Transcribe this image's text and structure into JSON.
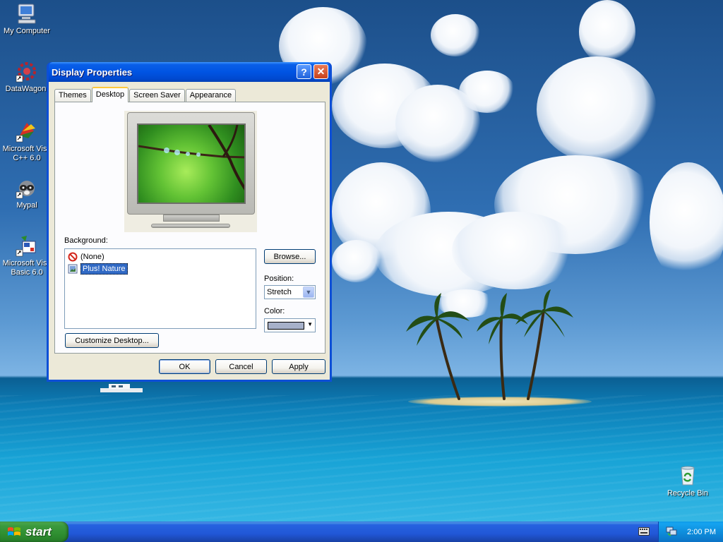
{
  "desktop": {
    "icons": [
      {
        "label_line1": "My Computer",
        "label_line2": ""
      },
      {
        "label_line1": "DataWagon.",
        "label_line2": ""
      },
      {
        "label_line1": "Microsoft Visu",
        "label_line2": "C++ 6.0"
      },
      {
        "label_line1": "Mypal",
        "label_line2": ""
      },
      {
        "label_line1": "Microsoft Visu",
        "label_line2": "Basic 6.0"
      },
      {
        "label_line1": "Recycle Bin",
        "label_line2": ""
      }
    ]
  },
  "dialog": {
    "title": "Display Properties",
    "help_glyph": "?",
    "close_glyph": "✕",
    "tabs": [
      {
        "label": "Themes",
        "active": false
      },
      {
        "label": "Desktop",
        "active": true
      },
      {
        "label": "Screen Saver",
        "active": false
      },
      {
        "label": "Appearance",
        "active": false
      }
    ],
    "background_label": "Background:",
    "background_items": [
      {
        "label": "(None)",
        "icon": "none-icon",
        "selected": false
      },
      {
        "label": "Plus! Nature",
        "icon": "picture-icon",
        "selected": true
      }
    ],
    "browse_label": "Browse...",
    "position_label": "Position:",
    "position_value": "Stretch",
    "color_label": "Color:",
    "color_value": "#a7b1c9",
    "customize_label": "Customize Desktop...",
    "ok_label": "OK",
    "cancel_label": "Cancel",
    "apply_label": "Apply"
  },
  "taskbar": {
    "start_label": "start",
    "clock": "2:00 PM"
  },
  "colors": {
    "title_bar": "#0054e3",
    "selection": "#316ac5",
    "taskbar": "#245edb",
    "start_button": "#3c9a3e",
    "tab_highlight": "#ffc83c"
  }
}
